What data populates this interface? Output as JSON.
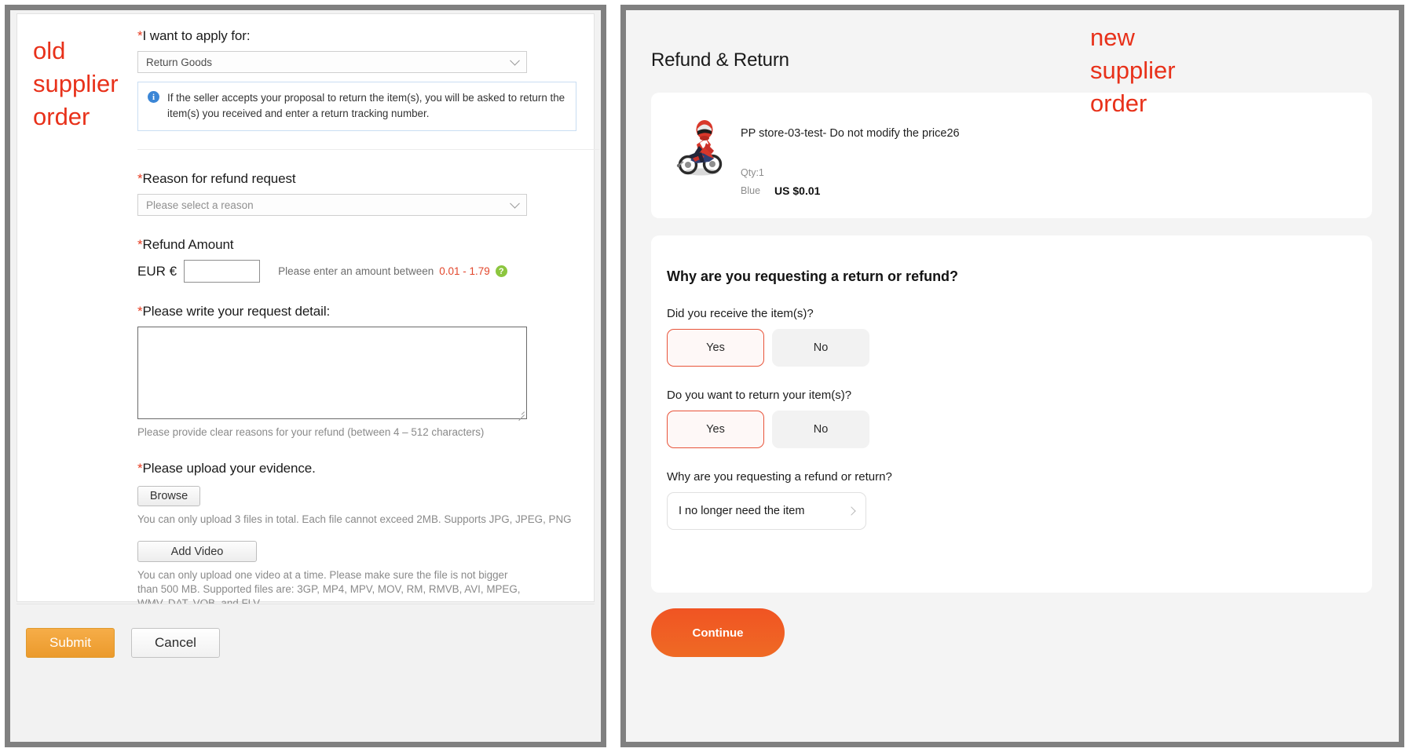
{
  "annotations": {
    "left": "old\nsupplier\norder",
    "right": "new\nsupplier\norder",
    "color": "#e8311a"
  },
  "old_order_form": {
    "apply_for": {
      "label": "I want to apply for:",
      "required_mark": "*",
      "value": "Return Goods",
      "caret_icon": "chevron-down-icon"
    },
    "info_banner": {
      "icon": "info-icon",
      "text": "If the seller accepts your proposal to return the item(s), you will be asked to return the item(s) you received and enter a return tracking number."
    },
    "reason": {
      "label": "Reason for refund request",
      "required_mark": "*",
      "placeholder": "Please select a reason",
      "caret_icon": "chevron-down-icon"
    },
    "refund_amount": {
      "label": "Refund Amount",
      "required_mark": "*",
      "currency": "EUR €",
      "value": "",
      "hint_prefix": "Please enter an amount between ",
      "hint_range": "0.01 - 1.79",
      "help_icon": "question-mark-icon"
    },
    "request_detail": {
      "label": "Please write your request detail:",
      "required_mark": "*",
      "value": "",
      "hint": "Please provide clear reasons for your refund (between 4 – 512 characters)"
    },
    "evidence": {
      "label": "Please upload your evidence.",
      "required_mark": "*",
      "browse_label": "Browse",
      "browse_hint": "You can only upload 3 files in total. Each file cannot exceed 2MB. Supports JPG, JPEG, PNG",
      "add_video_label": "Add Video",
      "video_hint": "You can only upload one video at a time. Please make sure the file is not bigger than 500 MB. Supported files are: 3GP, MP4, MPV, MOV, RM, RMVB, AVI, MPEG, WMV, DAT, VOB, and FLV."
    },
    "actions": {
      "submit_label": "Submit",
      "cancel_label": "Cancel",
      "submit_color": "#eb9a2c"
    }
  },
  "new_order_flow": {
    "title": "Refund & Return",
    "product": {
      "thumb_icon": "motorcycle-rider-image",
      "name": "PP store-03-test- Do not modify the price26",
      "qty": "Qty:1",
      "variant": "Blue",
      "price": "US $0.01"
    },
    "questions": {
      "heading": "Why are you requesting a return or refund?",
      "received": {
        "label": "Did you receive the item(s)?",
        "options": [
          "Yes",
          "No"
        ],
        "selected": "Yes"
      },
      "want_return": {
        "label": "Do you want to return your item(s)?",
        "options": [
          "Yes",
          "No"
        ],
        "selected": "Yes"
      },
      "reason": {
        "label": "Why are you requesting a refund or return?",
        "value": "I no longer need the item",
        "chevron_icon": "chevron-right-icon"
      }
    },
    "continue_label": "Continue",
    "continue_color": "#f05423"
  }
}
